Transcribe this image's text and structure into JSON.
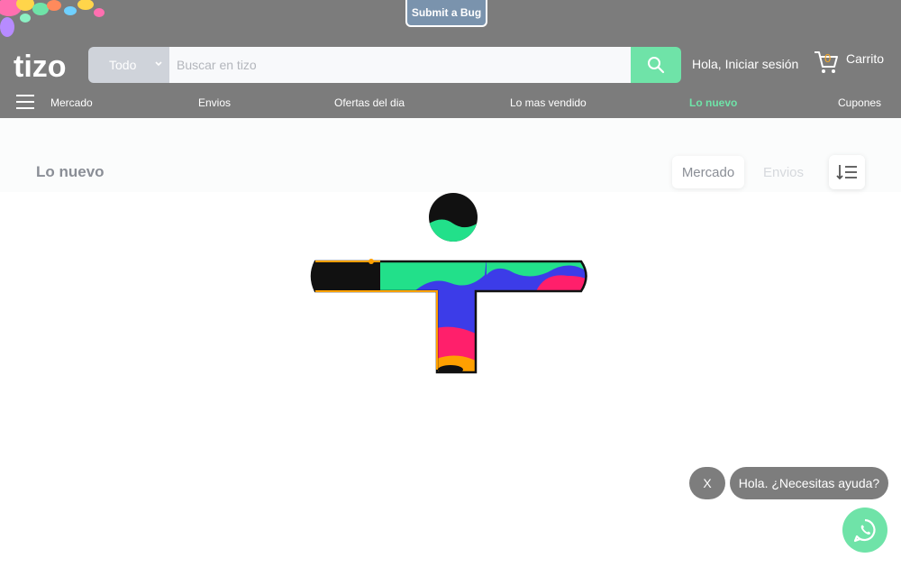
{
  "topbar": {
    "bug_button_label": "Submit a Bug"
  },
  "header": {
    "logo_text": "tizo",
    "search": {
      "category": "Todo",
      "placeholder": "Buscar en tizo",
      "value": ""
    },
    "login_label": "Hola, Iniciar sesión",
    "cart": {
      "count": "0",
      "label": "Carrito"
    }
  },
  "nav": {
    "items": [
      {
        "label": "Mercado"
      },
      {
        "label": "Envios"
      },
      {
        "label": "Ofertas del dia"
      },
      {
        "label": "Lo mas vendido"
      },
      {
        "label": "Lo nuevo",
        "active": true
      },
      {
        "label": "Cupones"
      }
    ]
  },
  "subheader": {
    "title": "Lo nuevo",
    "filters": [
      {
        "label": "Mercado",
        "selected": true
      },
      {
        "label": "Envios",
        "selected": false
      }
    ]
  },
  "chat": {
    "close_label": "X",
    "prompt": "Hola. ¿Necesitas ayuda?"
  },
  "icons": {
    "search": "search-icon",
    "cart": "cart-icon",
    "menu": "hamburger-icon",
    "sort": "sort-icon",
    "whatsapp": "whatsapp-icon"
  },
  "colors": {
    "header_bg": "#7c7c7c",
    "accent": "#6fe3a8",
    "bug_button": "#7a93ad",
    "cart_count": "#f5a623"
  }
}
